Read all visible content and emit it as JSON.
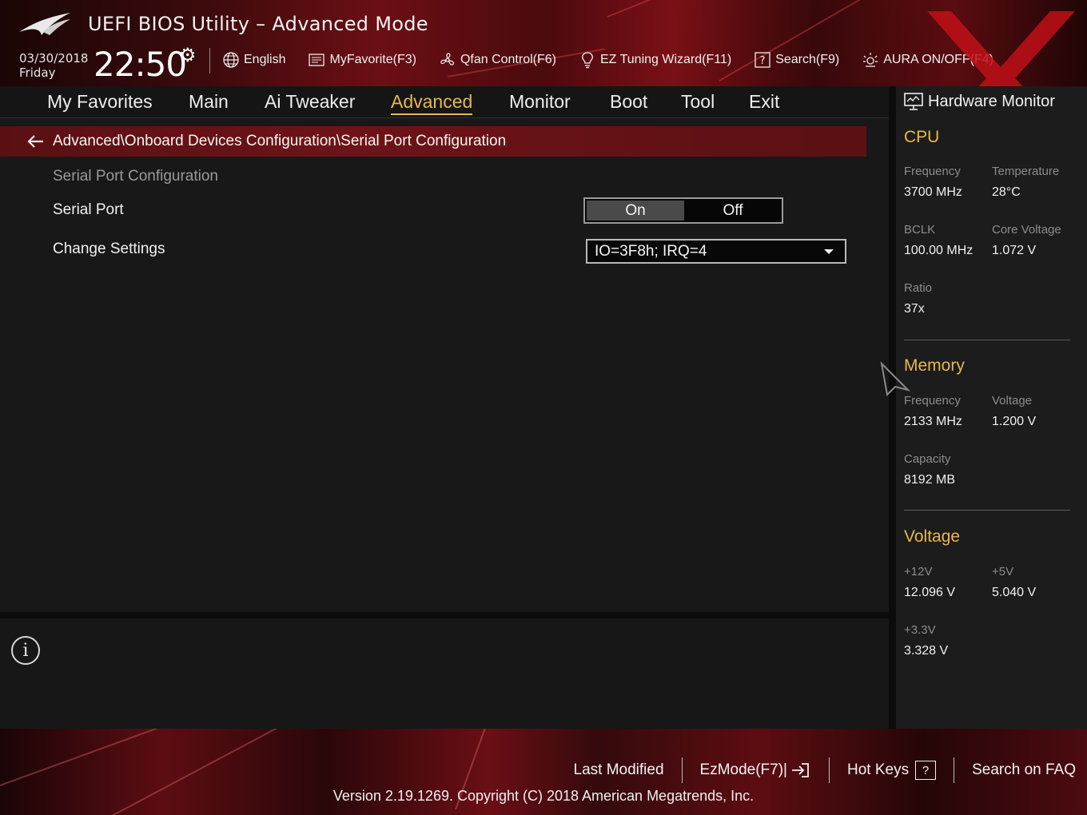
{
  "header": {
    "title": "UEFI BIOS Utility – Advanced Mode",
    "date": "03/30/2018",
    "day": "Friday",
    "time": "22:50",
    "toolbar": [
      {
        "label": "English",
        "icon": "globe-icon"
      },
      {
        "label": "MyFavorite(F3)",
        "icon": "favorite-list-icon"
      },
      {
        "label": "Qfan Control(F6)",
        "icon": "fan-icon"
      },
      {
        "label": "EZ Tuning Wizard(F11)",
        "icon": "lightbulb-icon"
      },
      {
        "label": "Search(F9)",
        "icon": "question-box-icon"
      },
      {
        "label": "AURA ON/OFF(F4)",
        "icon": "aura-light-icon"
      }
    ]
  },
  "menu": {
    "items": [
      "My Favorites",
      "Main",
      "Ai Tweaker",
      "Advanced",
      "Monitor",
      "Boot",
      "Tool",
      "Exit"
    ],
    "active": "Advanced"
  },
  "main": {
    "breadcrumb": "Advanced\\Onboard Devices Configuration\\Serial Port Configuration",
    "section_title": "Serial Port Configuration",
    "serial_port": {
      "label": "Serial Port",
      "on_label": "On",
      "off_label": "Off",
      "selected": "On"
    },
    "change_settings": {
      "label": "Change Settings",
      "value": "IO=3F8h; IRQ=4"
    }
  },
  "hardware_monitor": {
    "title": "Hardware Monitor",
    "cpu": {
      "title": "CPU",
      "frequency_label": "Frequency",
      "frequency": "3700 MHz",
      "temperature_label": "Temperature",
      "temperature": "28°C",
      "bclk_label": "BCLK",
      "bclk": "100.00 MHz",
      "core_voltage_label": "Core Voltage",
      "core_voltage": "1.072 V",
      "ratio_label": "Ratio",
      "ratio": "37x"
    },
    "memory": {
      "title": "Memory",
      "frequency_label": "Frequency",
      "frequency": "2133 MHz",
      "voltage_label": "Voltage",
      "voltage": "1.200 V",
      "capacity_label": "Capacity",
      "capacity": "8192 MB"
    },
    "voltage": {
      "title": "Voltage",
      "v12_label": "+12V",
      "v12": "12.096 V",
      "v5_label": "+5V",
      "v5": "5.040 V",
      "v33_label": "+3.3V",
      "v33": "3.328 V"
    }
  },
  "footer": {
    "last_modified": "Last Modified",
    "ezmode": "EzMode(F7)|",
    "hot_keys": "Hot Keys",
    "hot_keys_key": "?",
    "search_faq": "Search on FAQ",
    "copyright": "Version 2.19.1269. Copyright (C) 2018 American Megatrends, Inc."
  },
  "colors": {
    "accent": "#e5b84d",
    "breadcrumb_bg": "#6e1317",
    "panel_bg": "#181818"
  }
}
